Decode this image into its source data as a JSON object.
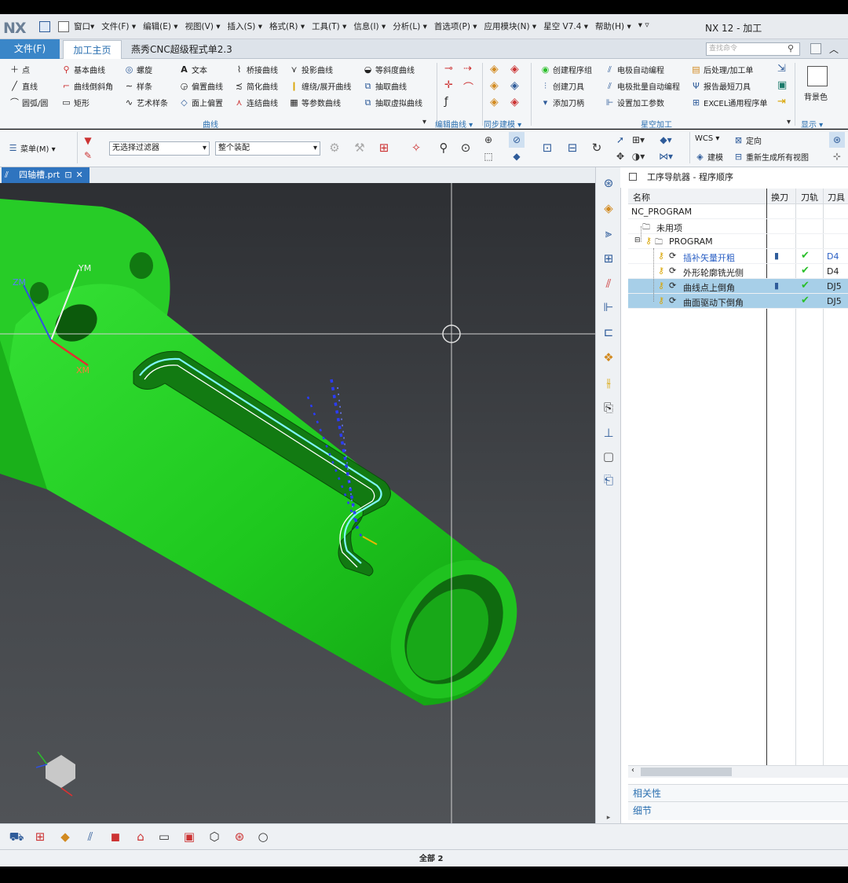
{
  "titlebar": {
    "logo": "NX",
    "menus": [
      "窗口▾",
      "文件(F) ▾",
      "编辑(E) ▾",
      "视图(V) ▾",
      "插入(S) ▾",
      "格式(R) ▾",
      "工具(T) ▾",
      "信息(I) ▾",
      "分析(L) ▾",
      "首选项(P) ▾",
      "应用模块(N) ▾",
      "星空 V7.4 ▾",
      "帮助(H) ▾",
      "▾ ▿"
    ],
    "app_title": "NX 12 - 加工"
  },
  "tabs": {
    "file": "文件(F)",
    "home": "加工主页",
    "custom": "燕秀CNC超级程式单2.3"
  },
  "search": {
    "placeholder": "查找命令"
  },
  "ribbon": {
    "curve_items": [
      "点",
      "直线",
      "圆弧/圆",
      "基本曲线",
      "曲线倒斜角",
      "矩形",
      "螺旋",
      "样条",
      "艺术样条",
      "文本",
      "偏置曲线",
      "面上偏置",
      "桥接曲线",
      "简化曲线",
      "连结曲线",
      "投影曲线",
      "缠绕/展开曲线",
      "等参数曲线",
      "等斜度曲线",
      "抽取曲线",
      "抽取虚拟曲线"
    ],
    "edit_label": "编辑曲线 ▾",
    "sync_label": "同步建模 ▾",
    "curve_group": "曲线",
    "xk_items": [
      "创建程序组",
      "创建刀具",
      "添加刀柄",
      "电极自动编程",
      "电极批量自动编程",
      "设置加工参数",
      "后处理/加工单",
      "报告最短刀具",
      "EXCEL通用程序单"
    ],
    "xk_group": "星空加工",
    "bg_label": "背景色",
    "display_label": "显示 ▾"
  },
  "secbar": {
    "menu_label": "菜单(M) ▾",
    "filter": "无选择过滤器",
    "assembly": "整个装配",
    "wcs": "WCS ▾",
    "orient": "定向",
    "model": "建模",
    "regen": "重新生成所有视图"
  },
  "doc_tab": {
    "name": "四轴槽.prt"
  },
  "navigator": {
    "title": "工序导航器 - 程序顺序",
    "columns": [
      "名称",
      "换刀",
      "刀轨",
      "刀具"
    ],
    "rows": [
      {
        "name": "NC_PROGRAM",
        "tool": ""
      },
      {
        "name": "未用项",
        "tool": ""
      },
      {
        "name": "PROGRAM",
        "tool": ""
      },
      {
        "name": "插补矢量开粗",
        "tool": "D4"
      },
      {
        "name": "外形轮廓铣光侧",
        "tool": "D4"
      },
      {
        "name": "曲线点上倒角",
        "tool": "DJ5"
      },
      {
        "name": "曲面驱动下倒角",
        "tool": "DJ5"
      }
    ],
    "sections": [
      "相关性",
      "细节"
    ]
  },
  "axis_labels": {
    "ym": "YM",
    "xm": "XM",
    "zm": "ZM"
  },
  "status": {
    "text": "全部 2"
  },
  "colors": {
    "part": "#1fcf1f",
    "accent": "#2f74bf",
    "highlight": "#a7cfe8",
    "check": "#2bbf2b",
    "tool_text": "#2a5fc4"
  }
}
